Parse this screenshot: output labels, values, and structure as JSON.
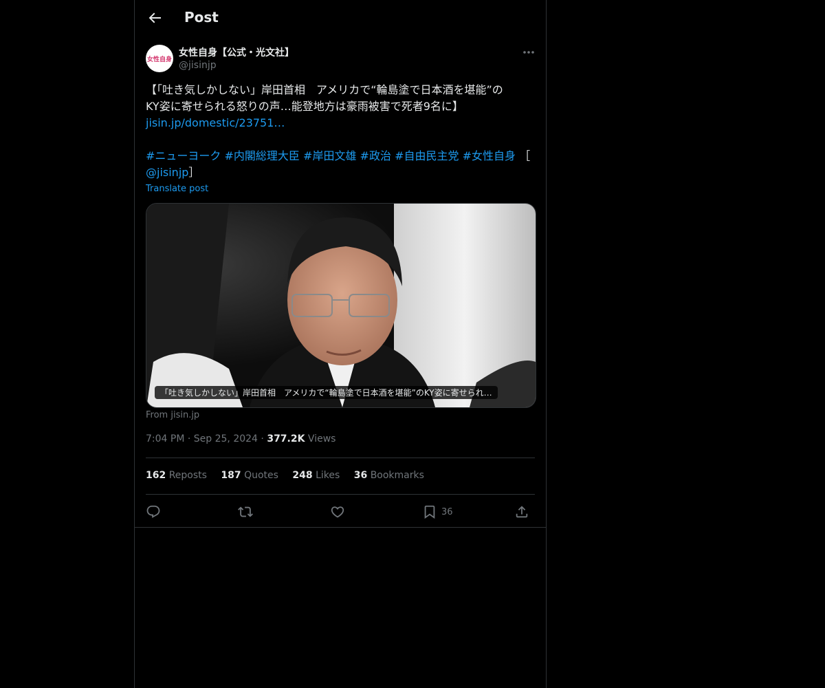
{
  "header": {
    "title": "Post",
    "back_icon": "arrow-left-icon"
  },
  "author": {
    "display_name": "女性自身【公式・光文社】",
    "handle": "@jisinjp",
    "avatar_text": "女性自身"
  },
  "post": {
    "line1": "【「吐き気しかしない」岸田首相　アメリカで“輪島塗で日本酒を堪能”の",
    "line2": "KY姿に寄せられる怒りの声…能登地方は豪雨被害で死者9名に】",
    "link": "jisin.jp/domestic/23751…",
    "hashtags": [
      "#ニューヨーク",
      "#内閣総理大臣",
      "#岸田文雄",
      "#政治",
      "#自由民主党",
      "#女性自身"
    ],
    "bracket_open": "［",
    "mention": "@jisinjp",
    "bracket_close": "］",
    "translate": "Translate post"
  },
  "media": {
    "caption": "「吐き気しかしない」岸田首相　アメリカで“輪島塗で日本酒を堪能”のKY姿に寄せられ…",
    "from": "From jisin.jp"
  },
  "meta": {
    "time": "7:04 PM",
    "dot": "·",
    "date": "Sep 25, 2024",
    "views_num": "377.2K",
    "views_label": "Views"
  },
  "stats": {
    "reposts_num": "162",
    "reposts_label": "Reposts",
    "quotes_num": "187",
    "quotes_label": "Quotes",
    "likes_num": "248",
    "likes_label": "Likes",
    "bookmarks_num": "36",
    "bookmarks_label": "Bookmarks"
  },
  "actions": {
    "bookmark_count": "36"
  },
  "colors": {
    "background": "#000000",
    "accent": "#1d9bf0",
    "muted": "#71767b",
    "text": "#e7e9ea",
    "border": "#2f3336"
  }
}
